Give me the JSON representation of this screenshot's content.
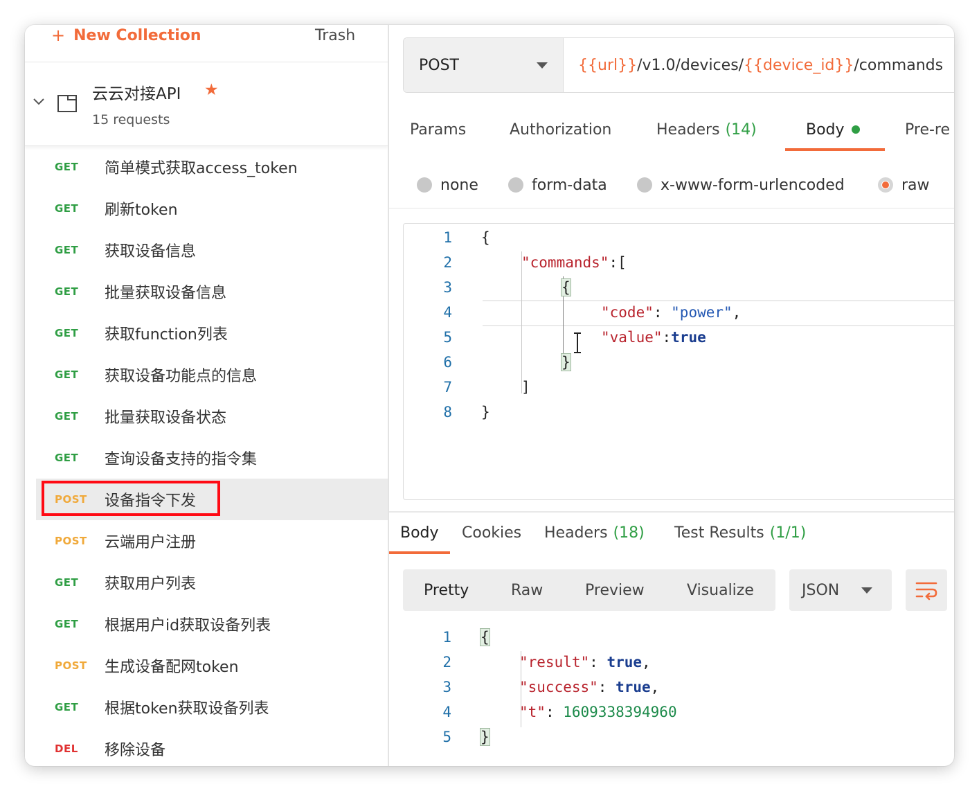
{
  "sidebar": {
    "new_collection_label": "New Collection",
    "trash_label": "Trash",
    "collection": {
      "name": "云云对接API",
      "count": "15 requests"
    },
    "requests": [
      {
        "method": "GET",
        "name": "简单模式获取access_token"
      },
      {
        "method": "GET",
        "name": "刷新token"
      },
      {
        "method": "GET",
        "name": "获取设备信息"
      },
      {
        "method": "GET",
        "name": "批量获取设备信息"
      },
      {
        "method": "GET",
        "name": "获取function列表"
      },
      {
        "method": "GET",
        "name": "获取设备功能点的信息"
      },
      {
        "method": "GET",
        "name": "批量获取设备状态"
      },
      {
        "method": "GET",
        "name": "查询设备支持的指令集"
      },
      {
        "method": "POST",
        "name": "设备指令下发"
      },
      {
        "method": "POST",
        "name": "云端用户注册"
      },
      {
        "method": "GET",
        "name": "获取用户列表"
      },
      {
        "method": "GET",
        "name": "根据用户id获取设备列表"
      },
      {
        "method": "POST",
        "name": "生成设备配网token"
      },
      {
        "method": "GET",
        "name": "根据token获取设备列表"
      },
      {
        "method": "DEL",
        "name": "移除设备"
      }
    ]
  },
  "request": {
    "method": "POST",
    "url": {
      "var1": "{{url}}",
      "part1": "/v1.0/devices/",
      "var2": "{{device_id}}",
      "part2": "/commands"
    },
    "tabs": {
      "params": "Params",
      "authorization": "Authorization",
      "headers": "Headers",
      "headers_count": "(14)",
      "body": "Body",
      "prerequest": "Pre-re"
    },
    "body_modes": {
      "none": "none",
      "form_data": "form-data",
      "urlencoded": "x-www-form-urlencoded",
      "raw": "raw"
    },
    "body_code": {
      "line_numbers": [
        "1",
        "2",
        "3",
        "4",
        "5",
        "6",
        "7",
        "8"
      ],
      "open_brace": "{",
      "commands_key": "\"commands\"",
      "colon_bracket": ":[",
      "inner_open": "{",
      "code_key": "\"code\"",
      "colon_sp": ": ",
      "code_value": "\"power\"",
      "comma": ",",
      "value_key": "\"value\"",
      "colon": ":",
      "value_value": "true",
      "inner_close": "}",
      "close_bracket": "]",
      "close_brace": "}"
    }
  },
  "response": {
    "tabs": {
      "body": "Body",
      "cookies": "Cookies",
      "headers": "Headers",
      "headers_count": "(18)",
      "tests": "Test Results",
      "tests_count": "(1/1)"
    },
    "views": {
      "pretty": "Pretty",
      "raw": "Raw",
      "preview": "Preview",
      "visualize": "Visualize"
    },
    "format": "JSON",
    "code": {
      "line_numbers": [
        "1",
        "2",
        "3",
        "4",
        "5"
      ],
      "open_brace": "{",
      "result_key": "\"result\"",
      "result_value": "true",
      "success_key": "\"success\"",
      "success_value": "true",
      "t_key": "\"t\"",
      "t_value": "1609338394960",
      "colon_sp": ": ",
      "comma": ",",
      "close_brace": "}"
    }
  },
  "colors": {
    "accent": "#f26b3a",
    "get": "#2f9e44",
    "post": "#f0a93a",
    "delete": "#e03131",
    "highlight_box": "#ff0a14"
  }
}
